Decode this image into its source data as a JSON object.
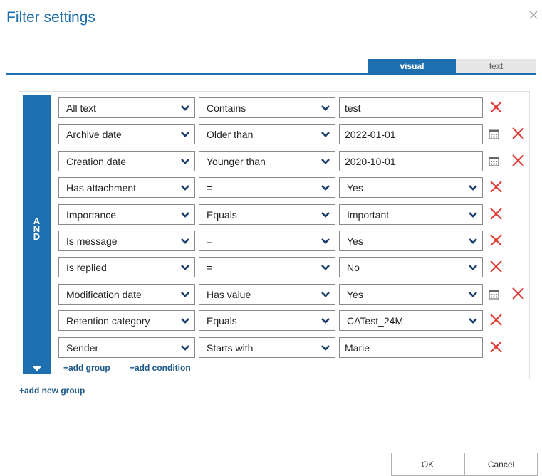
{
  "dialog": {
    "title": "Filter settings",
    "close_icon": "close-icon"
  },
  "tabs": [
    {
      "label": "visual",
      "active": true
    },
    {
      "label": "text",
      "active": false
    }
  ],
  "group": {
    "operator_letters": [
      "A",
      "N",
      "D"
    ],
    "toggle_icon": "triangle-down-icon",
    "add_group": "+add group",
    "add_condition": "+add condition"
  },
  "conditions": [
    {
      "field": "All text",
      "operator": "Contains",
      "value": "test",
      "value_type": "text",
      "calendar": false
    },
    {
      "field": "Archive date",
      "operator": "Older than",
      "value": "2022-01-01",
      "value_type": "text",
      "calendar": true
    },
    {
      "field": "Creation date",
      "operator": "Younger than",
      "value": "2020-10-01",
      "value_type": "text",
      "calendar": true
    },
    {
      "field": "Has attachment",
      "operator": "=",
      "value": "Yes",
      "value_type": "select",
      "calendar": false
    },
    {
      "field": "Importance",
      "operator": "Equals",
      "value": "Important",
      "value_type": "select",
      "calendar": false
    },
    {
      "field": "Is message",
      "operator": "=",
      "value": "Yes",
      "value_type": "select",
      "calendar": false
    },
    {
      "field": "Is replied",
      "operator": "=",
      "value": "No",
      "value_type": "select",
      "calendar": false
    },
    {
      "field": "Modification date",
      "operator": "Has value",
      "value": "Yes",
      "value_type": "select",
      "calendar": true
    },
    {
      "field": "Retention category",
      "operator": "Equals",
      "value": "CATest_24M",
      "value_type": "select",
      "calendar": false
    },
    {
      "field": "Sender",
      "operator": "Starts with",
      "value": "Marie",
      "value_type": "text",
      "calendar": false
    }
  ],
  "add_new_group": "+add new group",
  "buttons": {
    "ok": "OK",
    "cancel": "Cancel"
  },
  "colors": {
    "accent": "#1e6faf",
    "delete": "#e53935",
    "link": "#1e5a8a"
  }
}
